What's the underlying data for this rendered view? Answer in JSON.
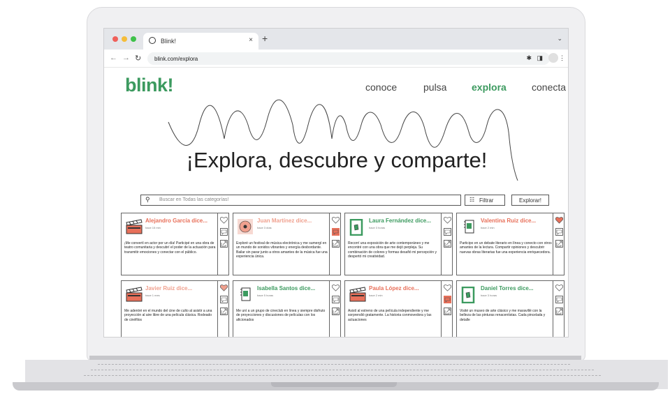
{
  "browser": {
    "tab_title": "Blink!",
    "close_glyph": "×",
    "newtab_glyph": "+",
    "address": "blink.com/explora",
    "traffic": {
      "red": "#f0605a",
      "yellow": "#f5bd3a",
      "green": "#3ec14a"
    }
  },
  "site": {
    "logo": "blink!",
    "nav": [
      "conoce",
      "pulsa",
      "explora",
      "conecta"
    ],
    "active_nav": "explora",
    "hero": "¡Explora, descubre y comparte!",
    "search_placeholder": "Buscar en Todas las categorías!",
    "filter_label": "Filtrar",
    "explore_label": "Explorar!",
    "accent_green": "#3c9a5f",
    "accent_orange": "#e8705a",
    "accent_salmon": "#f0a08e"
  },
  "cards": [
    {
      "name": "Alejandro García dice...",
      "time": "hace 15 min",
      "icon": "clapperboard-icon",
      "text": "¡Me convertí en actor por un día! Participé en una obra de teatro comunitaria y descubrí el poder de la actuación para transmitir emociones y conectar con el público.",
      "heart": "outline",
      "comment": "outline"
    },
    {
      "name": "Juan Martínez dice...",
      "time": "hace 3 días",
      "icon": "vinyl-icon",
      "text": "Exploré un festival de música electrónica y me sumergí en un mundo de sonidos vibrantes y energía desbordante. Bailar sin parar junto a otros amantes de la música fue una experiencia única.",
      "heart": "outline",
      "comment": "filled"
    },
    {
      "name": "Laura Fernández dice...",
      "time": "hace 3 horas",
      "icon": "painting-icon",
      "text": "Recorrí una exposición de arte contemporáneo y me encontré con una obra que me dejó perpleja. Su combinación de colores y formas desafió mi percepción y despertó mi creatividad.",
      "heart": "outline",
      "comment": "outline"
    },
    {
      "name": "Valentina Ruiz dice...",
      "time": "hace 2 min",
      "icon": "book-icon",
      "text": "Participo en un debate literario en línea y conecto con otros amantes de la lectura. Compartir opiniones y descubrir nuevas obras literarias fue una experiencia enriquecedora.",
      "heart": "filled",
      "comment": "outline"
    },
    {
      "name": "Javier Ruiz dice...",
      "time": "hace 1 mes",
      "icon": "clapperboard-icon",
      "text": "Me adentré en el mundo del cine de culto al asistir a una proyección al aire libre de una película clásica. Rodeado de cinéfilos",
      "heart": "filled-light",
      "comment": "outline"
    },
    {
      "name": "Isabella Santos dice...",
      "time": "hace 5 horas",
      "icon": "book-icon",
      "text": "Me uní a un grupo de cineclub en línea y siempre disfruto de proyecciones y discusiones de películas con los aficionados",
      "heart": "outline",
      "comment": "outline"
    },
    {
      "name": "Paula López dice...",
      "time": "hace 2 min",
      "icon": "clapperboard-icon",
      "text": "Asistí al estreno de una película independiente y me sorprendió gratamente. La historia conmovedora y las actuaciones",
      "heart": "outline",
      "comment": "filled"
    },
    {
      "name": "Daniel Torres dice...",
      "time": "hace 3 horas",
      "icon": "painting-icon",
      "text": "Visité un museo de arte clásico y me maravillé con la belleza de las pinturas renacentistas. Cada pincelada y detalle",
      "heart": "outline",
      "comment": "outline"
    }
  ]
}
